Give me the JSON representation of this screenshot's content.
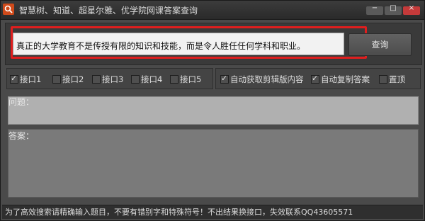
{
  "window": {
    "title": "智慧树、知道、超星尔雅、优学院网课答案查询",
    "buttons": {
      "minimize": "−",
      "maximize": "□",
      "close": "×"
    }
  },
  "query": {
    "value": "真正的大学教育不是传授有限的知识和技能，而是令人胜任任何学科和职业。",
    "button_label": "查询"
  },
  "interfaces": [
    {
      "label": "接口1",
      "checked": true
    },
    {
      "label": "接口2",
      "checked": false
    },
    {
      "label": "接口3",
      "checked": false
    },
    {
      "label": "接口4",
      "checked": false
    },
    {
      "label": "接口5",
      "checked": false
    }
  ],
  "options": [
    {
      "label": "自动获取剪辑版内容",
      "checked": true
    },
    {
      "label": "自动复制答案",
      "checked": true
    },
    {
      "label": "置顶",
      "checked": false
    }
  ],
  "question": {
    "label": "问题："
  },
  "answer": {
    "label": "答案："
  },
  "status": {
    "text": "为了高效搜索请精确输入题目，不要有错别字和特殊符号！不出结果换接口，失效联系QQ43605571"
  },
  "colors": {
    "highlight": "#e01e1e",
    "app_icon": "#d04a1a",
    "close_button": "#c43a3a"
  }
}
